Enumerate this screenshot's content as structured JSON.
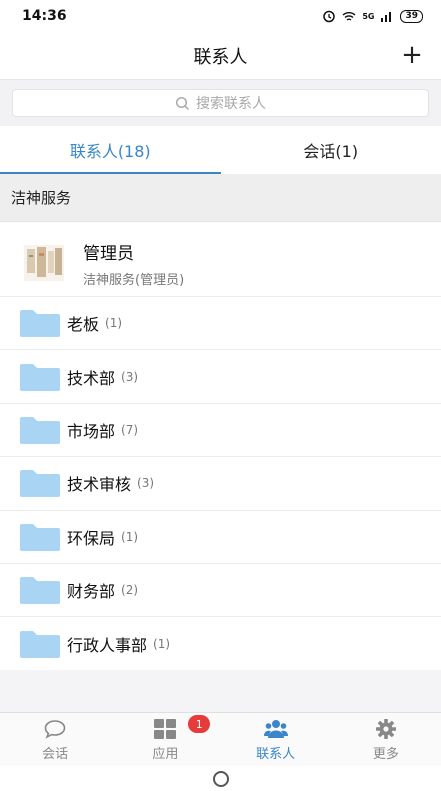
{
  "status_bar": {
    "time": "14:36",
    "battery": "39",
    "signal": "5G"
  },
  "header": {
    "title": "联系人",
    "add_label": "+"
  },
  "search": {
    "placeholder": "搜索联系人"
  },
  "tabs": [
    {
      "label": "联系人(18)",
      "active": true
    },
    {
      "label": "会话(1)",
      "active": false
    }
  ],
  "group": {
    "name": "洁神服务"
  },
  "admin": {
    "name": "管理员",
    "subtitle": "洁神服务(管理员)"
  },
  "folders": [
    {
      "name": "老板",
      "count": "(1)"
    },
    {
      "name": "技术部",
      "count": "(3)"
    },
    {
      "name": "市场部",
      "count": "(7)"
    },
    {
      "name": "技术审核",
      "count": "(3)"
    },
    {
      "name": "环保局",
      "count": "(1)"
    },
    {
      "name": "财务部",
      "count": "(2)"
    },
    {
      "name": "行政人事部",
      "count": "(1)"
    }
  ],
  "tabbar": [
    {
      "label": "会话",
      "icon": "chat-bubble-icon",
      "active": false
    },
    {
      "label": "应用",
      "icon": "grid-apps-icon",
      "active": false,
      "badge": "1"
    },
    {
      "label": "联系人",
      "icon": "people-icon",
      "active": true
    },
    {
      "label": "更多",
      "icon": "gear-icon",
      "active": false
    }
  ],
  "colors": {
    "accent": "#3a86c8",
    "folder": "#a9d4f3",
    "badge": "#e53b3b"
  }
}
